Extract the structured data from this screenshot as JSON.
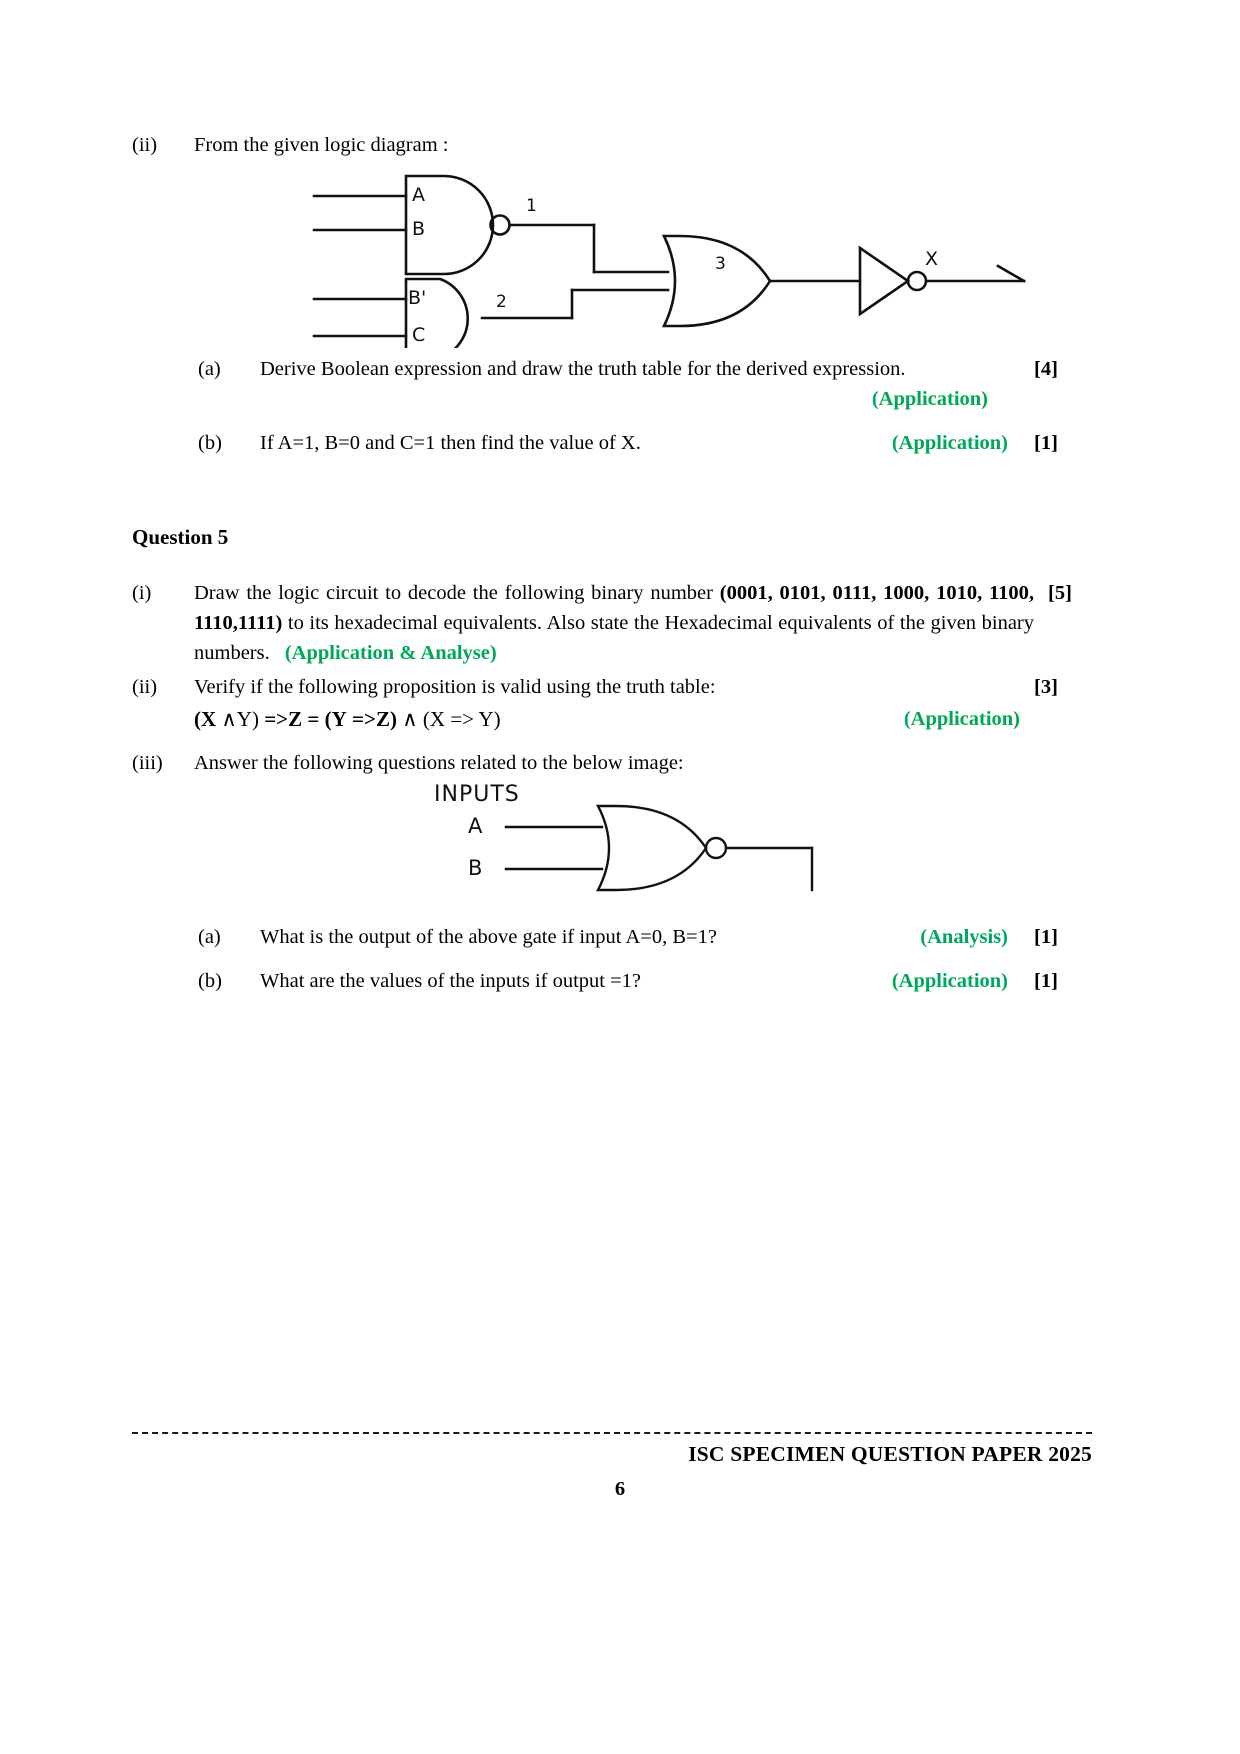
{
  "question4": {
    "item_ii": {
      "num": "(ii)",
      "text": "From the given logic diagram :"
    },
    "diagram1": {
      "labels": {
        "a": "A",
        "b": "B",
        "b_prime": "B'",
        "c": "C",
        "node1": "1",
        "node2": "2",
        "node3": "3",
        "output": "X"
      }
    },
    "part_a": {
      "num": "(a)",
      "text": "Derive Boolean expression and draw the truth table for the derived expression.",
      "skill": "(Application)",
      "marks": "[4]"
    },
    "part_b": {
      "num": "(b)",
      "text": "If A=1,  B=0 and C=1 then find the value of  X.",
      "skill": "(Application)",
      "marks": "[1]"
    }
  },
  "question5": {
    "heading": "Question 5",
    "item_i": {
      "num": "(i)",
      "text_1": "Draw the logic circuit to decode the following binary number ",
      "binary_bold": "(0001, 0101, 0111, 1000, 1010, 1100, 1110,1111)",
      "text_2": " to its hexadecimal equivalents. Also state the Hexadecimal equivalents of the given binary numbers.",
      "skill": "(Application & Analyse)",
      "marks": "[5]"
    },
    "item_ii": {
      "num": "(ii)",
      "text": "Verify if the following proposition is valid using the truth table:",
      "proposition_bold_1": "(X",
      "proposition_reg_1": " ∧Y)",
      "proposition_bold_2": " =>Z  =  (Y",
      "proposition_reg_2": " ",
      "proposition_bold_3": "=>Z)",
      "proposition_reg_3": " ∧ (X =>",
      "proposition_reg_4": " Y)",
      "proposition_full": "(X ∧Y) =>Z  =  (Y =>Z) ∧ (X => Y)",
      "skill": "(Application)",
      "marks": "[3]"
    },
    "item_iii": {
      "num": "(iii)",
      "text": "Answer the following questions related to the below image:"
    },
    "diagram2": {
      "labels": {
        "inputs": "INPUTS",
        "a": "A",
        "b": "B"
      }
    },
    "part_a": {
      "num": "(a)",
      "text": "What is the output of the above gate if input A=0, B=1?",
      "skill": "(Analysis)",
      "marks": "[1]"
    },
    "part_b": {
      "num": "(b)",
      "text": "What are the values of the inputs if output =1?",
      "skill": "(Application)",
      "marks": "[1]"
    }
  },
  "footer": {
    "title": "ISC SPECIMEN QUESTION PAPER 2025",
    "page_number": "6"
  },
  "colors": {
    "skill_green": "#00a65a",
    "text_black": "#000000",
    "diagram_line": "#111111"
  }
}
